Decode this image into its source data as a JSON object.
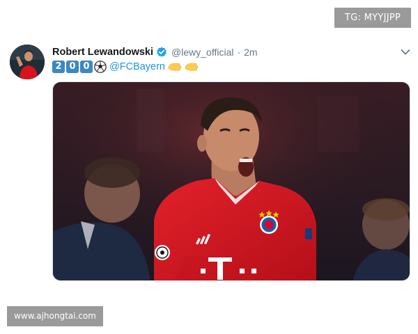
{
  "watermarks": {
    "top": "TG: MYYJJPP",
    "bottom": "www.ajhongtai.com"
  },
  "tweet": {
    "author": {
      "display_name": "Robert Lewandowski",
      "verified": true,
      "handle": "@lewy_official"
    },
    "separator": "·",
    "time": "2m",
    "text": {
      "keycaps": [
        "2",
        "0",
        "0"
      ],
      "emoji_after_number": "soccer-ball-icon",
      "mention": "@FCBayern",
      "trailing_emoji": [
        "clapping-hands-icon",
        "clapping-hands-icon"
      ]
    },
    "media": {
      "jersey_number_text": "T · ·"
    }
  },
  "colors": {
    "verified_blue": "#1da1f2",
    "mention_blue": "#1b95e0",
    "muted_gray": "#657786",
    "keycap_blue": "#3b88c3",
    "jersey_red": "#d7141e",
    "watermark_gray": "#9a9a9a"
  }
}
